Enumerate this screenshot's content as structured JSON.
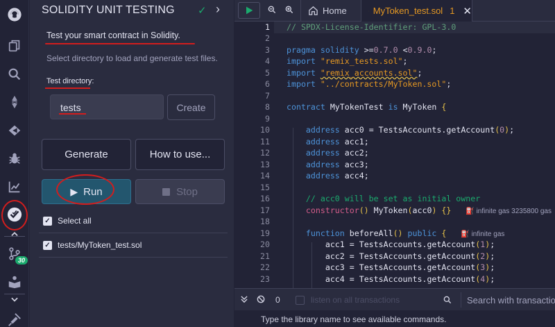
{
  "panel": {
    "title": "SOLIDITY UNIT TESTING",
    "intro": "Test your smart contract in Solidity.",
    "description": "Select directory to load and generate test files.",
    "dir_label": "Test directory:",
    "dir_value": "tests",
    "create_label": "Create",
    "generate_label": "Generate",
    "howto_label": "How to use...",
    "run_label": "Run",
    "stop_label": "Stop",
    "select_all_label": "Select all",
    "test_file_label": "tests/MyToken_test.sol"
  },
  "rail": {
    "badge": "30"
  },
  "tabs": {
    "home_label": "Home",
    "file_label": "MyToken_test.sol",
    "file_badge": "1"
  },
  "editor": {
    "line_numbers": [
      "1",
      "2",
      "3",
      "4",
      "5",
      "6",
      "7",
      "8",
      "9",
      "10",
      "11",
      "12",
      "13",
      "14",
      "15",
      "16",
      "17",
      "18",
      "19",
      "20",
      "21",
      "22",
      "23"
    ],
    "gas_17": "infinite gas 3235800 gas",
    "gas_19": "infinite gas"
  },
  "terminal": {
    "count": "0",
    "listen_label": "listen on all transactions",
    "search_placeholder": "Search with transaction ha",
    "hint": "Type the library name to see available commands."
  },
  "colors": {
    "accent_green": "#1bab6e",
    "annotation_red": "#d31d1d",
    "file_tab_orange": "#e69923"
  }
}
